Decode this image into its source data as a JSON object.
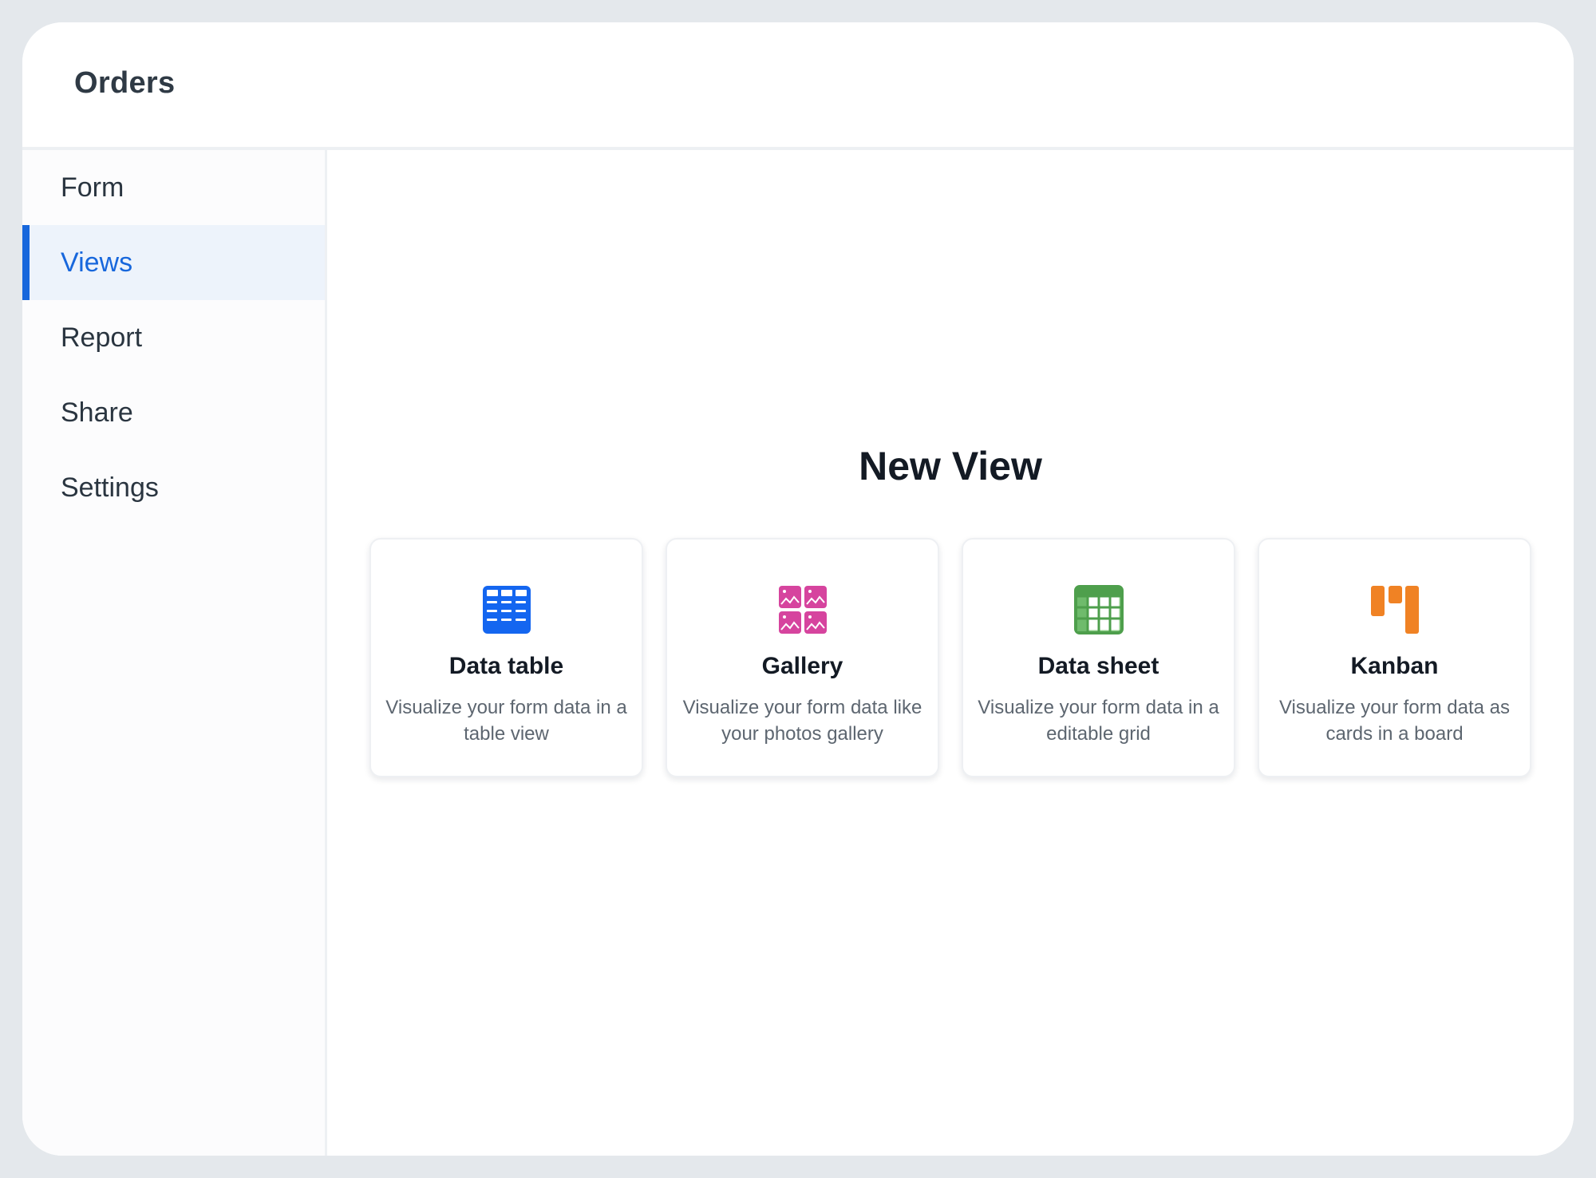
{
  "header": {
    "title": "Orders"
  },
  "sidebar": {
    "items": [
      {
        "label": "Form",
        "active": false
      },
      {
        "label": "Views",
        "active": true
      },
      {
        "label": "Report",
        "active": false
      },
      {
        "label": "Share",
        "active": false
      },
      {
        "label": "Settings",
        "active": false
      }
    ]
  },
  "main": {
    "title": "New View",
    "cards": [
      {
        "icon": "data-table-icon",
        "color": "#1466f0",
        "title": "Data table",
        "description": "Visualize your form data in a table view"
      },
      {
        "icon": "gallery-icon",
        "color": "#d6449e",
        "title": "Gallery",
        "description": "Visualize your form data like your photos gallery"
      },
      {
        "icon": "data-sheet-icon",
        "color": "#4e9f4c",
        "title": "Data sheet",
        "description": "Visualize your form data in a editable grid"
      },
      {
        "icon": "kanban-icon",
        "color": "#f08224",
        "title": "Kanban",
        "description": "Visualize your form data as cards in a board"
      }
    ]
  },
  "colors": {
    "accent": "#1767dc",
    "active_bg": "#edf3fb"
  }
}
